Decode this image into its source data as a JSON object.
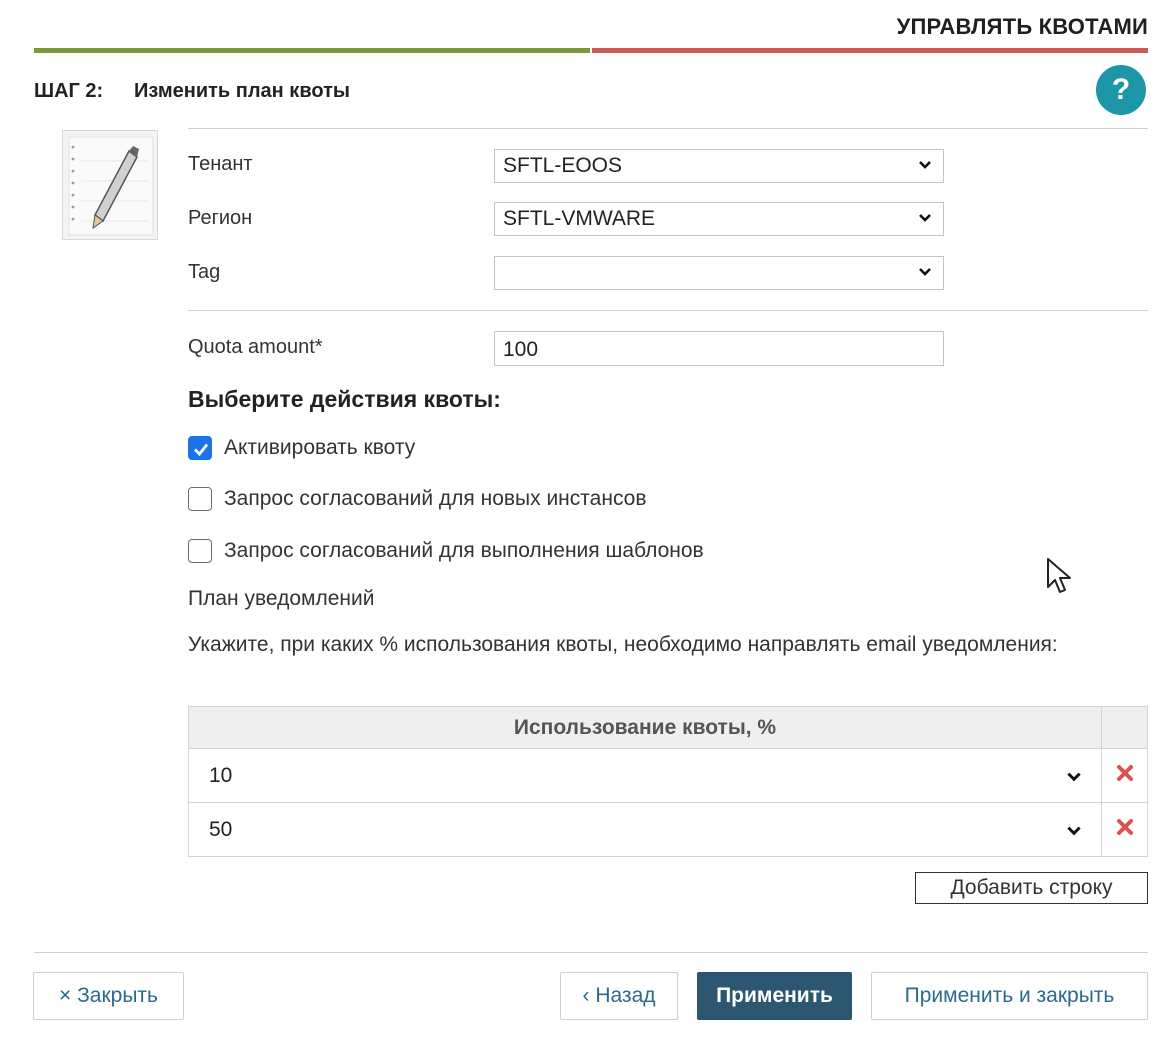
{
  "header": {
    "title": "УПРАВЛЯТЬ КВОТАМИ",
    "step_label": "ШАГ 2:",
    "step_title": "Изменить план квоты",
    "help_glyph": "?"
  },
  "colors": {
    "progress_done": "#7a9a3a",
    "progress_pending": "#cc5b58",
    "help": "#1d97a8",
    "primary_button": "#2d5670",
    "checkbox_checked": "#1a73e8",
    "delete": "#d9534f"
  },
  "form": {
    "tenant": {
      "label": "Тенант",
      "value": "SFTL-EOOS"
    },
    "region": {
      "label": "Регион",
      "value": "SFTL-VMWARE"
    },
    "tag": {
      "label": "Tag",
      "value": ""
    },
    "quota_amount": {
      "label": "Quota amount*",
      "value": "100"
    }
  },
  "actions": {
    "heading": "Выберите действия квоты:",
    "items": [
      {
        "label": "Активировать квоту",
        "checked": true
      },
      {
        "label": "Запрос согласований для новых инстансов",
        "checked": false
      },
      {
        "label": "Запрос согласований для выполнения шаблонов",
        "checked": false
      }
    ]
  },
  "notifications": {
    "title": "План уведомлений",
    "description": "Укажите, при каких % использования квоты, необходимо направлять email уведомления:",
    "column_header": "Использование квоты, %",
    "rows": [
      {
        "value": "10"
      },
      {
        "value": "50"
      }
    ],
    "add_row_label": "Добавить строку"
  },
  "footer": {
    "close_label": "× Закрыть",
    "back_label": "‹ Назад",
    "apply_label": "Применить",
    "apply_close_label": "Применить и закрыть"
  }
}
